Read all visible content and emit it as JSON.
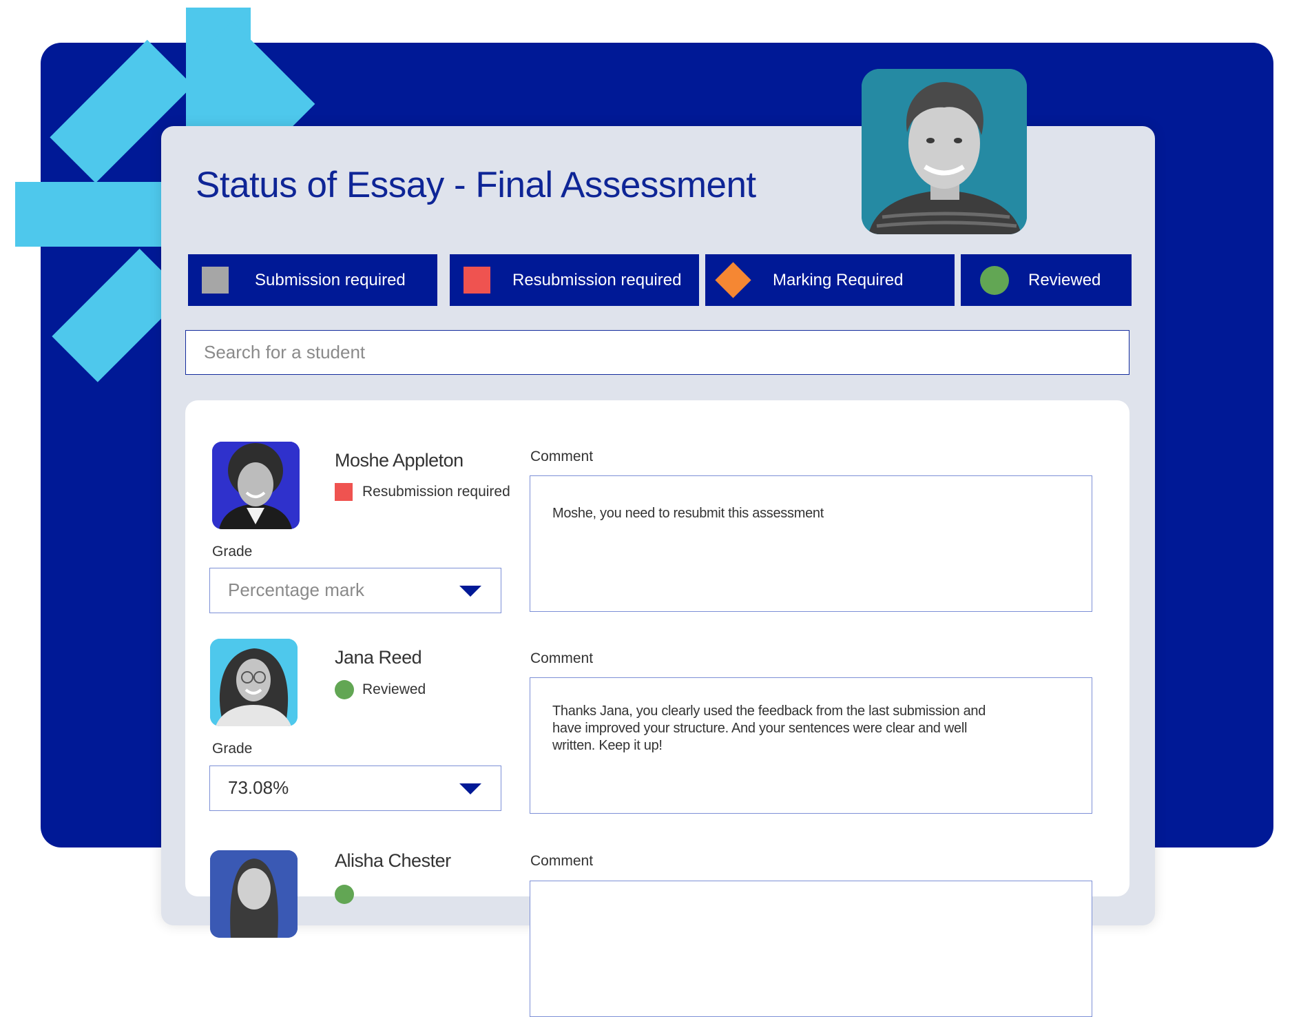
{
  "header": {
    "title": "Status of Essay - Final Assessment"
  },
  "legend": [
    {
      "label": "Submission required",
      "icon": "grey-square-icon",
      "color": "#a6a6a6"
    },
    {
      "label": "Resubmission required",
      "icon": "red-square-icon",
      "color": "#ef5350"
    },
    {
      "label": "Marking Required",
      "icon": "orange-diamond-icon",
      "color": "#f58733"
    },
    {
      "label": "Reviewed",
      "icon": "green-circle-icon",
      "color": "#62a654"
    }
  ],
  "search": {
    "placeholder": "Search for a student",
    "value": ""
  },
  "labels": {
    "grade": "Grade",
    "comment": "Comment"
  },
  "students": [
    {
      "name": "Moshe Appleton",
      "status": "Resubmission required",
      "status_icon": "red-square-icon",
      "grade_placeholder": "Percentage mark",
      "grade_value": "",
      "comment": "Moshe, you need to resubmit this assessment"
    },
    {
      "name": "Jana Reed",
      "status": "Reviewed",
      "status_icon": "green-circle-icon",
      "grade_placeholder": "",
      "grade_value": "73.08%",
      "comment": "Thanks Jana, you clearly used the feedback from the last submission and have improved your structure. And your sentences were clear and well written. Keep it up!"
    },
    {
      "name": "Alisha Chester",
      "status": "",
      "status_icon": "green-circle-icon",
      "grade_placeholder": "",
      "grade_value": "",
      "comment": ""
    }
  ],
  "colors": {
    "brand_navy": "#001996",
    "accent_cyan": "#4ec8ec",
    "card_background": "#dfe3ec",
    "title_text": "#0e2596"
  }
}
